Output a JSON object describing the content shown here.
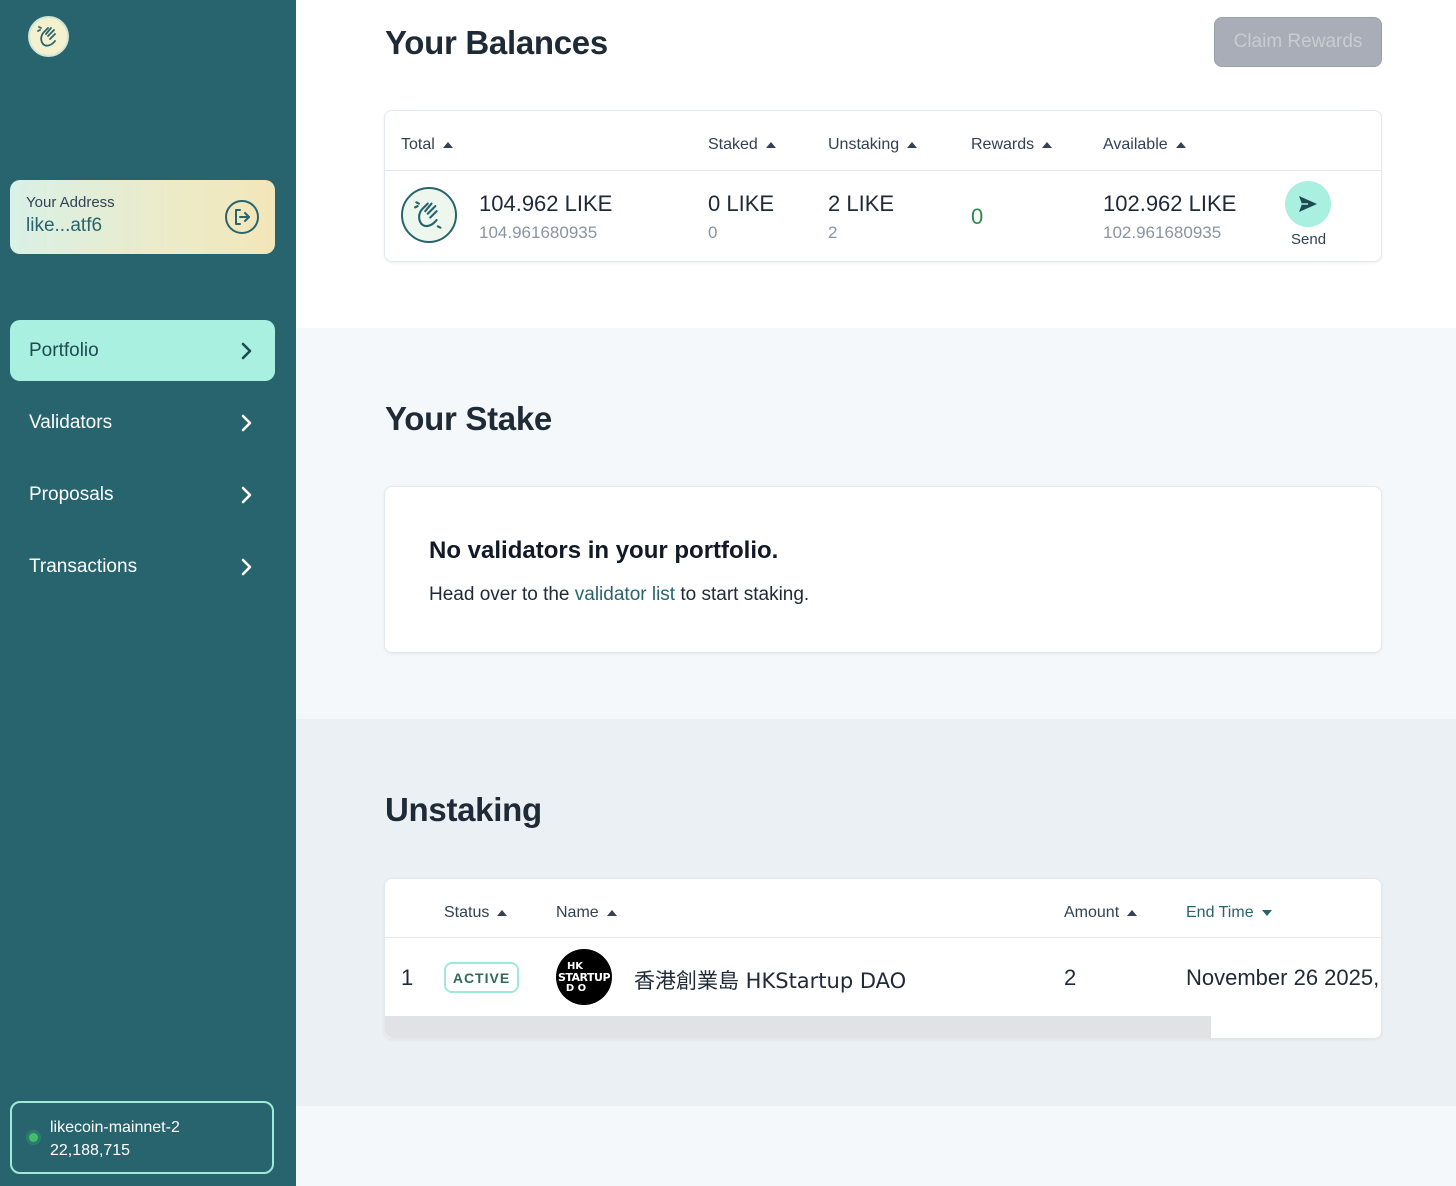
{
  "sidebar": {
    "address_label": "Your Address",
    "address_value": "like...atf6",
    "nav": [
      {
        "label": "Portfolio",
        "active": true
      },
      {
        "label": "Validators",
        "active": false
      },
      {
        "label": "Proposals",
        "active": false
      },
      {
        "label": "Transactions",
        "active": false
      }
    ],
    "chain": {
      "name": "likecoin-mainnet-2",
      "block_height": "22,188,715",
      "status_color": "#3fbf6a"
    }
  },
  "balances": {
    "title": "Your Balances",
    "claim_button": "Claim Rewards",
    "columns": {
      "total": "Total",
      "staked": "Staked",
      "unstaking": "Unstaking",
      "rewards": "Rewards",
      "available": "Available"
    },
    "row": {
      "total": "104.962 LIKE",
      "total_exact": "104.961680935",
      "staked": "0 LIKE",
      "staked_exact": "0",
      "unstaking": "2 LIKE",
      "unstaking_exact": "2",
      "rewards": "0",
      "available": "102.962 LIKE",
      "available_exact": "102.961680935"
    },
    "send_label": "Send"
  },
  "stake": {
    "title": "Your Stake",
    "empty_title": "No validators in your portfolio.",
    "empty_prefix": "Head over to the ",
    "empty_link": "validator list",
    "empty_suffix": " to start staking."
  },
  "unstaking": {
    "title": "Unstaking",
    "columns": {
      "status": "Status",
      "name": "Name",
      "amount": "Amount",
      "end_time": "End Time"
    },
    "rows": [
      {
        "index": "1",
        "status": "ACTIVE",
        "avatar_text": [
          "HK",
          "STARTUP",
          "D O"
        ],
        "name": "香港創業島 HKStartup DAO",
        "amount": "2",
        "end_time": "November 26 2025,"
      }
    ]
  },
  "colors": {
    "sidebar": "#28646e",
    "accent": "#aaf0e1",
    "rewards_green": "#2f8a4e"
  }
}
